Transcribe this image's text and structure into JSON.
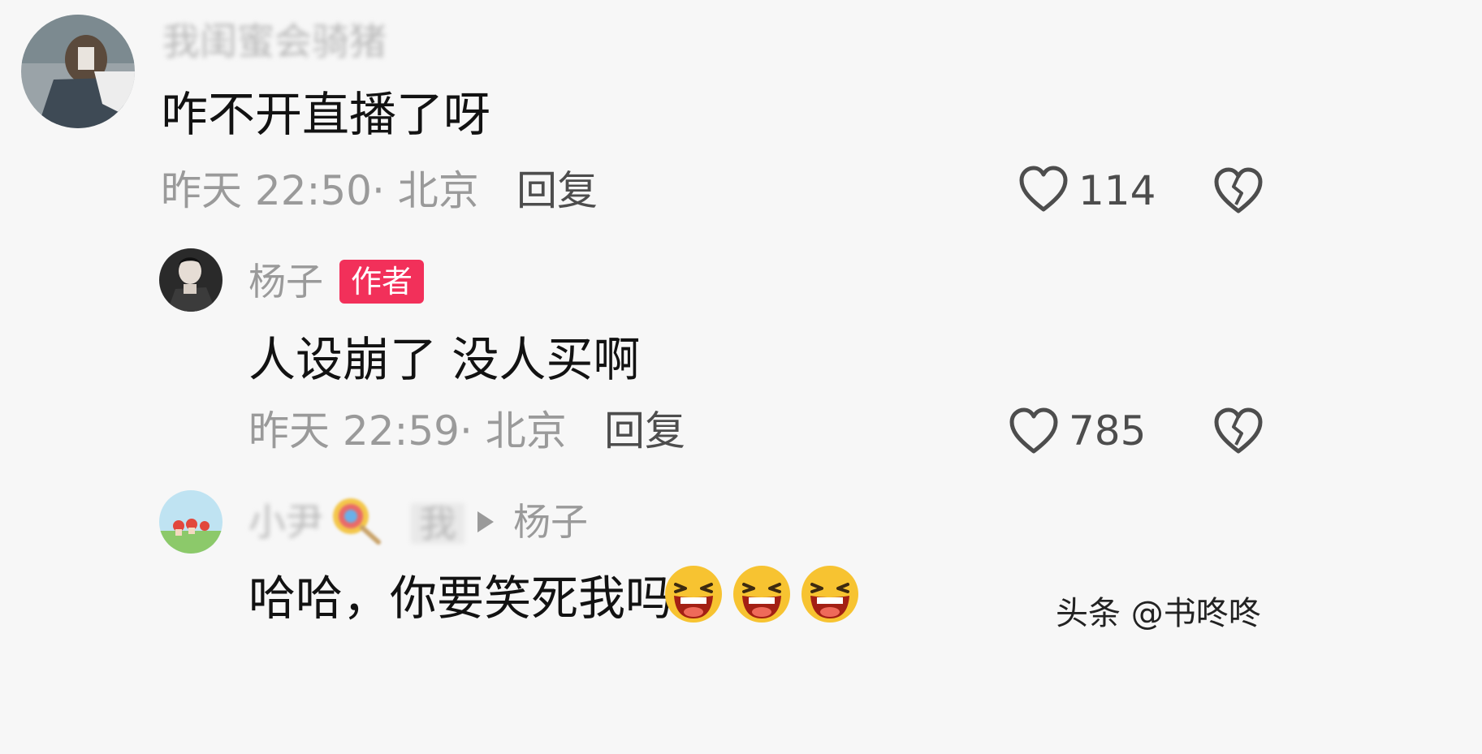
{
  "comments": [
    {
      "username": "我闺蜜会骑猪",
      "content": "咋不开直播了呀",
      "time_location": "昨天 22:50· 北京",
      "reply_label": "回复",
      "likes": "114"
    },
    {
      "username": "杨子",
      "author_badge": "作者",
      "content": "人设崩了 没人买啊",
      "time_location": "昨天 22:59· 北京",
      "reply_label": "回复",
      "likes": "785"
    },
    {
      "username": "小尹",
      "username_tag": "我",
      "reply_to": "杨子",
      "content": "哈哈，你要笑死我吗"
    }
  ],
  "watermark": "头条 @书咚咚",
  "icons": {
    "like": "heart-outline-icon",
    "dislike": "broken-heart-icon",
    "reply_arrow": "triangle-right-icon",
    "emoji": "laughing-emoji-icon",
    "lollipop": "lollipop-icon"
  }
}
